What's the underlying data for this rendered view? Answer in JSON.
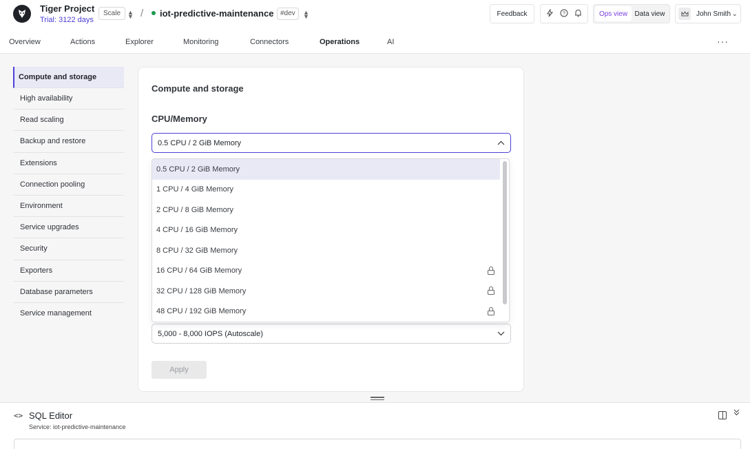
{
  "header": {
    "project_name": "Tiger Project",
    "trial": "Trial: 3122 days",
    "plan": "Scale",
    "separator": "/",
    "service_name": "iot-predictive-maintenance",
    "env": "#dev",
    "feedback": "Feedback",
    "ops_view": "Ops view",
    "data_view": "Data view",
    "user": "John Smith"
  },
  "nav": {
    "tabs": [
      "Overview",
      "Actions",
      "Explorer",
      "Monitoring",
      "Connectors",
      "Operations",
      "AI"
    ],
    "active": "Operations",
    "more": "···"
  },
  "sidebar": {
    "items": [
      "Compute and storage",
      "High availability",
      "Read scaling",
      "Backup and restore",
      "Extensions",
      "Connection pooling",
      "Environment",
      "Service upgrades",
      "Security",
      "Exporters",
      "Database parameters",
      "Service management"
    ],
    "active": "Compute and storage"
  },
  "main": {
    "title": "Compute and storage",
    "cpu_section": "CPU/Memory",
    "cpu_selected": "0.5 CPU / 2 GiB Memory",
    "cpu_options": [
      {
        "label": "0.5 CPU / 2 GiB Memory",
        "locked": false,
        "selected": true
      },
      {
        "label": "1 CPU / 4 GiB Memory",
        "locked": false,
        "selected": false
      },
      {
        "label": "2 CPU / 8 GiB Memory",
        "locked": false,
        "selected": false
      },
      {
        "label": "4 CPU / 16 GiB Memory",
        "locked": false,
        "selected": false
      },
      {
        "label": "8 CPU / 32 GiB Memory",
        "locked": false,
        "selected": false
      },
      {
        "label": "16 CPU / 64 GiB Memory",
        "locked": true,
        "selected": false
      },
      {
        "label": "32 CPU / 128 GiB Memory",
        "locked": true,
        "selected": false
      },
      {
        "label": "48 CPU / 192 GiB Memory",
        "locked": true,
        "selected": false
      }
    ],
    "iops_selected": "5,000 - 8,000 IOPS (Autoscale)",
    "apply": "Apply"
  },
  "sql_editor": {
    "title": "SQL Editor",
    "service": "Service: iot-predictive-maintenance"
  },
  "colors": {
    "accent": "#4b3fd6",
    "ops_view": "#7a3fe4",
    "status": "#1c9a4e"
  }
}
